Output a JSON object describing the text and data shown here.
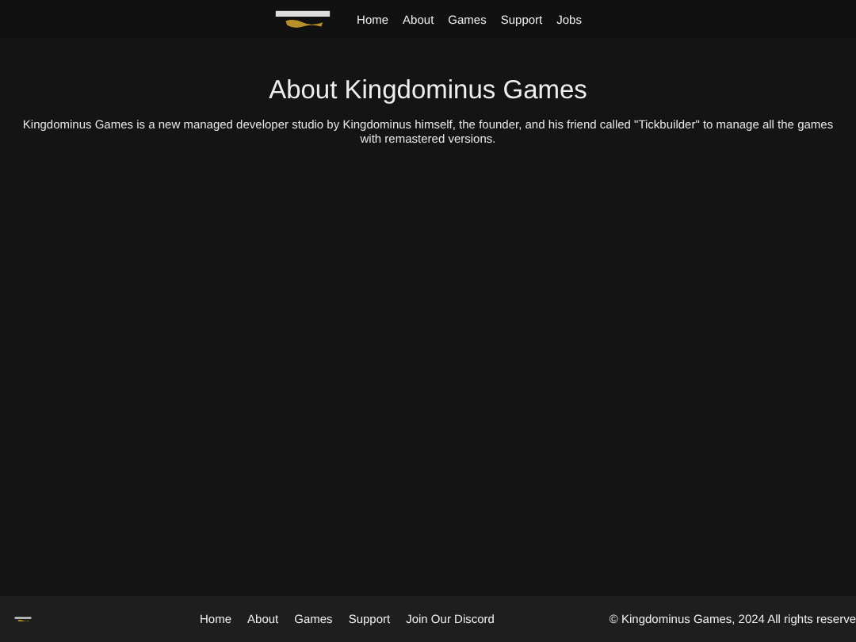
{
  "header": {
    "nav": [
      "Home",
      "About",
      "Games",
      "Support",
      "Jobs"
    ]
  },
  "main": {
    "title": "About Kingdominus Games",
    "text": "Kingdominus Games is a new managed developer studio by Kingdominus himself, the founder, and his friend called \"Tickbuilder\" to manage all the games with remastered versions."
  },
  "footer": {
    "links": [
      "Home",
      "About",
      "Games",
      "Support",
      "Join Our Discord"
    ],
    "copyright": "© Kingdominus Games, 2024 All rights reserve"
  }
}
